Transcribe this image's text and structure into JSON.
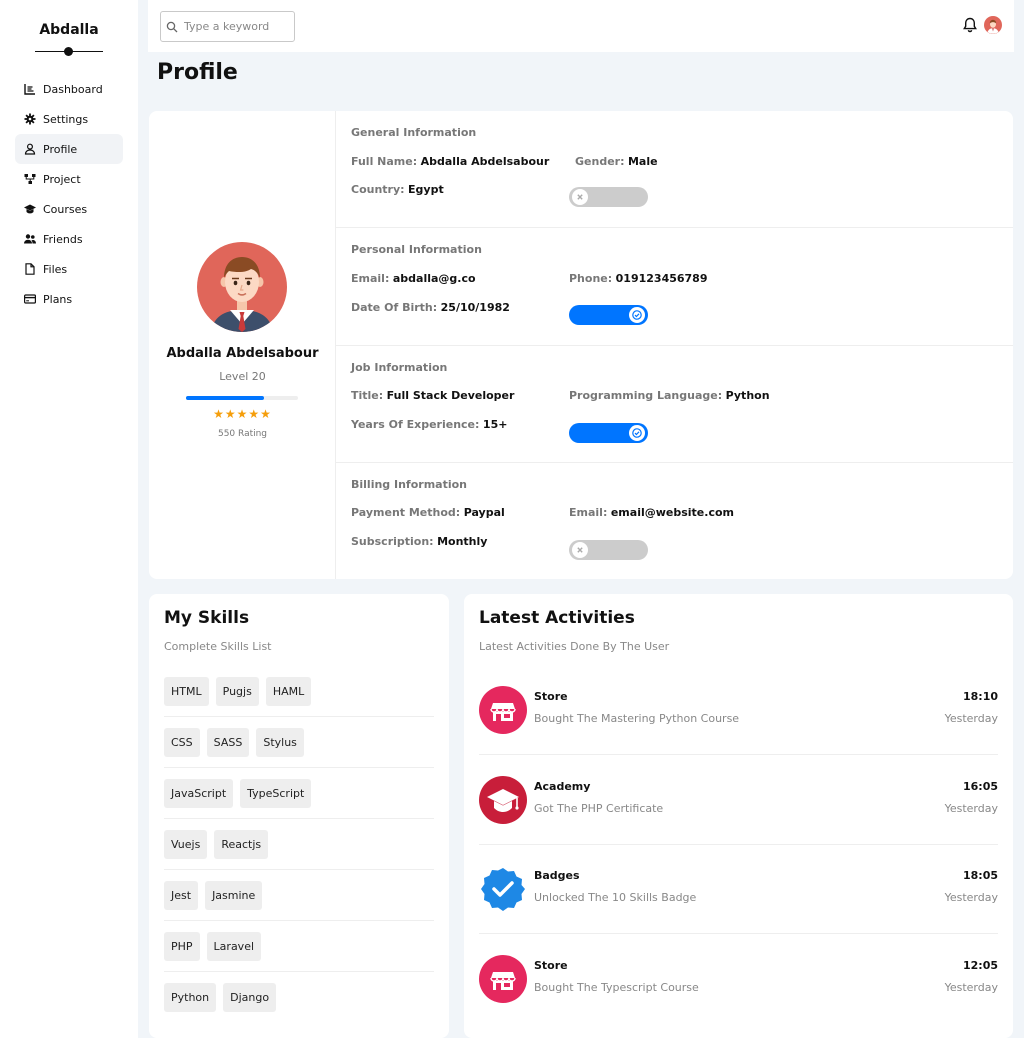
{
  "sidebar": {
    "brand": "Abdalla",
    "items": [
      {
        "label": "Dashboard",
        "icon": "chart-icon"
      },
      {
        "label": "Settings",
        "icon": "gear-icon"
      },
      {
        "label": "Profile",
        "icon": "user-icon",
        "active": true
      },
      {
        "label": "Project",
        "icon": "diagram-icon"
      },
      {
        "label": "Courses",
        "icon": "graduation-cap-icon"
      },
      {
        "label": "Friends",
        "icon": "users-icon"
      },
      {
        "label": "Files",
        "icon": "file-icon"
      },
      {
        "label": "Plans",
        "icon": "credit-card-icon"
      }
    ]
  },
  "topbar": {
    "search_placeholder": "Type a keyword"
  },
  "page": {
    "title": "Profile"
  },
  "profile": {
    "name": "Abdalla Abdelsabour",
    "level": "Level 20",
    "progress": 0.7,
    "stars": "★★★★★",
    "rating": "550 Rating"
  },
  "general": {
    "title": "General Information",
    "full_name_label": "Full Name:",
    "full_name": "Abdalla Abdelsabour",
    "gender_label": "Gender:",
    "gender": "Male",
    "country_label": "Country:",
    "country": "Egypt",
    "toggle_on": false
  },
  "personal": {
    "title": "Personal Information",
    "email_label": "Email:",
    "email": "abdalla@g.co",
    "phone_label": "Phone:",
    "phone": "019123456789",
    "dob_label": "Date Of Birth:",
    "dob": "25/10/1982",
    "toggle_on": true
  },
  "job": {
    "title": "Job Information",
    "title_label": "Title:",
    "job_title": "Full Stack Developer",
    "lang_label": "Programming Language:",
    "lang": "Python",
    "exp_label": "Years Of Experience:",
    "exp": "15+",
    "toggle_on": true
  },
  "billing": {
    "title": "Billing Information",
    "method_label": "Payment Method:",
    "method": "Paypal",
    "email_label": "Email:",
    "email": "email@website.com",
    "sub_label": "Subscription:",
    "sub": "Monthly",
    "toggle_on": false
  },
  "skills": {
    "title": "My Skills",
    "subtitle": "Complete Skills List",
    "rows": [
      [
        "HTML",
        "Pugjs",
        "HAML"
      ],
      [
        "CSS",
        "SASS",
        "Stylus"
      ],
      [
        "JavaScript",
        "TypeScript"
      ],
      [
        "Vuejs",
        "Reactjs"
      ],
      [
        "Jest",
        "Jasmine"
      ],
      [
        "PHP",
        "Laravel"
      ],
      [
        "Python",
        "Django"
      ]
    ]
  },
  "activities": {
    "title": "Latest Activities",
    "subtitle": "Latest Activities Done By The User",
    "items": [
      {
        "title": "Store",
        "desc": "Bought The Mastering Python Course",
        "time": "18:10",
        "day": "Yesterday",
        "icon": "store-icon",
        "color": "#e5285e"
      },
      {
        "title": "Academy",
        "desc": "Got The PHP Certificate",
        "time": "16:05",
        "day": "Yesterday",
        "icon": "graduation-cap-icon",
        "color": "#c81e3a"
      },
      {
        "title": "Badges",
        "desc": "Unlocked The 10 Skills Badge",
        "time": "18:05",
        "day": "Yesterday",
        "icon": "badge-check-icon",
        "color": "#1e88e5"
      },
      {
        "title": "Store",
        "desc": "Bought The Typescript Course",
        "time": "12:05",
        "day": "Yesterday",
        "icon": "store-icon",
        "color": "#e5285e"
      }
    ]
  }
}
